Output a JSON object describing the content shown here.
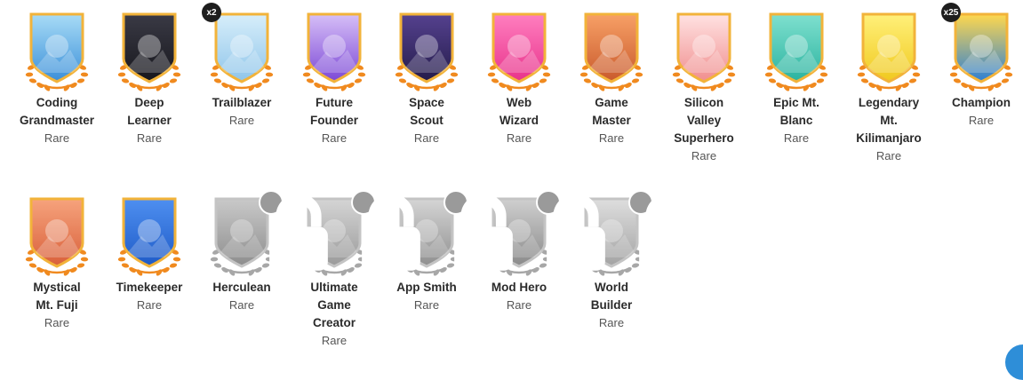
{
  "badges_row1": [
    {
      "name": "Coding\nGrandmaster",
      "rarity": "Rare",
      "icon": "coding-grandmaster-icon",
      "count": "",
      "locked": false,
      "c1": "#a8dcf6",
      "c2": "#3b8fd9"
    },
    {
      "name": "Deep\nLearner",
      "rarity": "Rare",
      "icon": "deep-learner-icon",
      "count": "",
      "locked": false,
      "c1": "#3a3a45",
      "c2": "#17171d"
    },
    {
      "name": "Trailblazer",
      "rarity": "Rare",
      "icon": "trailblazer-icon",
      "count": "x2",
      "locked": false,
      "c1": "#d7eefa",
      "c2": "#8fc5ea"
    },
    {
      "name": "Future\nFounder",
      "rarity": "Rare",
      "icon": "future-founder-icon",
      "count": "",
      "locked": false,
      "c1": "#d6bff7",
      "c2": "#7c48d6"
    },
    {
      "name": "Space\nScout",
      "rarity": "Rare",
      "icon": "space-scout-icon",
      "count": "",
      "locked": false,
      "c1": "#55418f",
      "c2": "#241c4a"
    },
    {
      "name": "Web\nWizard",
      "rarity": "Rare",
      "icon": "web-wizard-icon",
      "count": "",
      "locked": false,
      "c1": "#ff7fbf",
      "c2": "#e8338b"
    },
    {
      "name": "Game\nMaster",
      "rarity": "Rare",
      "icon": "game-master-icon",
      "count": "",
      "locked": false,
      "c1": "#f7a066",
      "c2": "#c95a2c"
    },
    {
      "name": "Silicon\nValley\nSuperhero",
      "rarity": "Rare",
      "icon": "silicon-valley-superhero-icon",
      "count": "",
      "locked": false,
      "c1": "#ffe2e2",
      "c2": "#f08e8e"
    },
    {
      "name": "Epic Mt.\nBlanc",
      "rarity": "Rare",
      "icon": "epic-mt-blanc-icon",
      "count": "",
      "locked": false,
      "c1": "#7fe0cf",
      "c2": "#2bb39f"
    },
    {
      "name": "Legendary\nMt.\nKilimanjaro",
      "rarity": "Rare",
      "icon": "legendary-mt-kilimanjaro-icon",
      "count": "",
      "locked": false,
      "c1": "#fff07a",
      "c2": "#f0c91e"
    },
    {
      "name": "Champion",
      "rarity": "Rare",
      "icon": "champion-icon",
      "count": "x25",
      "locked": false,
      "c1": "#ffd84d",
      "c2": "#2c7fd6"
    }
  ],
  "badges_row2": [
    {
      "name": "Mystical\nMt. Fuji",
      "rarity": "Rare",
      "icon": "mystical-mt-fuji-icon",
      "count": "",
      "locked": false,
      "c1": "#f6a37d",
      "c2": "#d9603a"
    },
    {
      "name": "Timekeeper",
      "rarity": "Rare",
      "icon": "timekeeper-icon",
      "count": "",
      "locked": false,
      "c1": "#4e8ff0",
      "c2": "#1f5bc7"
    },
    {
      "name": "Herculean",
      "rarity": "Rare",
      "icon": "herculean-icon",
      "count": "",
      "locked": true,
      "c1": "#c9c9c9",
      "c2": "#8d8d8d"
    },
    {
      "name": "Ultimate\nGame\nCreator",
      "rarity": "Rare",
      "icon": "ultimate-game-creator-icon",
      "count": "",
      "locked": true,
      "c1": "#d5d5d5",
      "c2": "#9a9a9a"
    },
    {
      "name": "App Smith",
      "rarity": "Rare",
      "icon": "app-smith-icon",
      "count": "",
      "locked": true,
      "c1": "#d5d5d5",
      "c2": "#8f8f8f"
    },
    {
      "name": "Mod Hero",
      "rarity": "Rare",
      "icon": "mod-hero-icon",
      "count": "",
      "locked": true,
      "c1": "#cfcfcf",
      "c2": "#8a8a8a"
    },
    {
      "name": "World\nBuilder",
      "rarity": "Rare",
      "icon": "world-builder-icon",
      "count": "",
      "locked": true,
      "c1": "#dedede",
      "c2": "#a3a3a3"
    }
  ],
  "colors": {
    "frame": "#f2b33a",
    "laurel": "#f08a1f",
    "locked_frame": "#c4c4c4",
    "locked_laurel": "#a7a7a7"
  }
}
